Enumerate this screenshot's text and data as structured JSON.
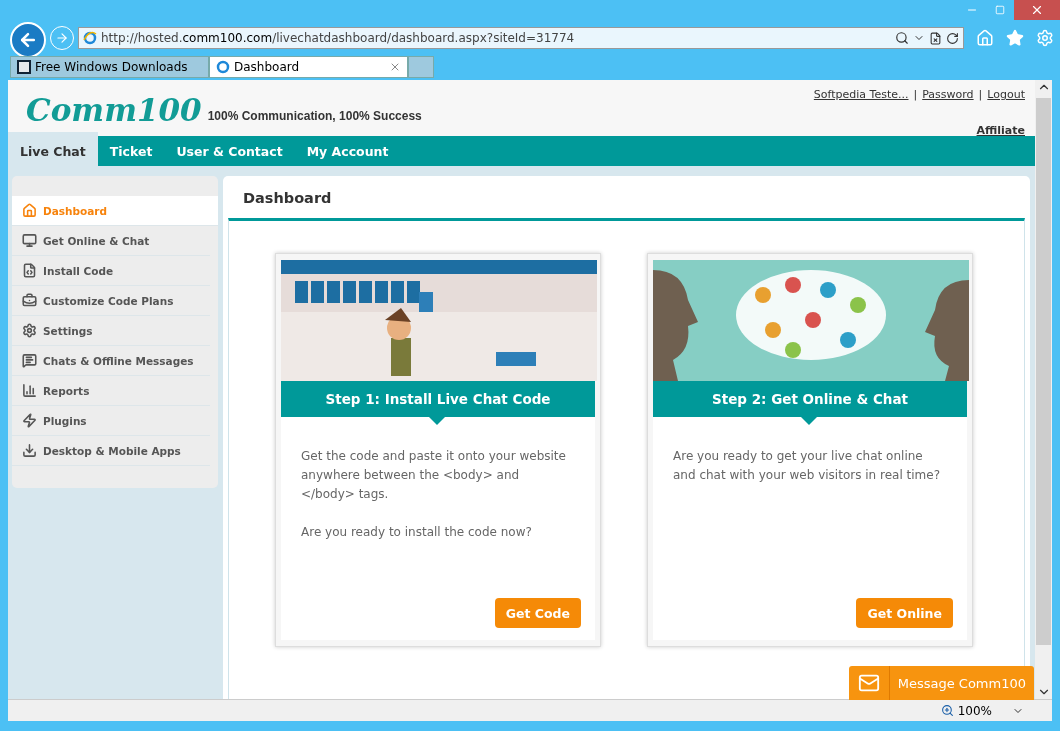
{
  "browser": {
    "url": "http://hosted.**comm100.com**/livechatdashboard/dashboard.aspx?siteId=31774",
    "tabs": [
      {
        "title": "Free Windows Downloads",
        "selected": false
      },
      {
        "title": "Dashboard",
        "selected": true
      }
    ],
    "zoom": "100%"
  },
  "header": {
    "logo": "Comm100",
    "tagline": "100% Communication, 100% Success",
    "user_bar": [
      {
        "kind": "link",
        "text": "Softpedia Teste..."
      },
      {
        "kind": "sep",
        "text": "|"
      },
      {
        "kind": "link",
        "text": "Password"
      },
      {
        "kind": "sep",
        "text": "|"
      },
      {
        "kind": "link",
        "text": "Logout"
      }
    ],
    "affiliate": "Affiliate"
  },
  "nav": [
    {
      "label": "Live Chat",
      "selected": true
    },
    {
      "label": "Ticket",
      "selected": false
    },
    {
      "label": "User & Contact",
      "selected": false
    },
    {
      "label": "My Account",
      "selected": false
    }
  ],
  "sidebar": [
    {
      "label": "Dashboard",
      "selected": true
    },
    {
      "label": "Get Online & Chat",
      "selected": false
    },
    {
      "label": "Install Code",
      "selected": false
    },
    {
      "label": "Customize Code Plans",
      "selected": false
    },
    {
      "label": "Settings",
      "selected": false
    },
    {
      "label": "Chats & Offline Messages",
      "selected": false
    },
    {
      "label": "Reports",
      "selected": false
    },
    {
      "label": "Plugins",
      "selected": false
    },
    {
      "label": "Desktop & Mobile Apps",
      "selected": false
    }
  ],
  "main": {
    "title": "Dashboard",
    "cards": [
      {
        "kind": "install",
        "title": "Step 1: Install Live Chat Code",
        "paragraphs": [
          "Get the code and paste it onto your website anywhere between the <body> and </body> tags.",
          "Are you ready to install the code now?"
        ],
        "button": "Get Code"
      },
      {
        "kind": "online",
        "title": "Step 2: Get Online & Chat",
        "paragraphs": [
          "Are you ready to get your live chat online and chat with your web visitors in real time?"
        ],
        "button": "Get Online"
      }
    ]
  },
  "message_button": "Message Comm100"
}
